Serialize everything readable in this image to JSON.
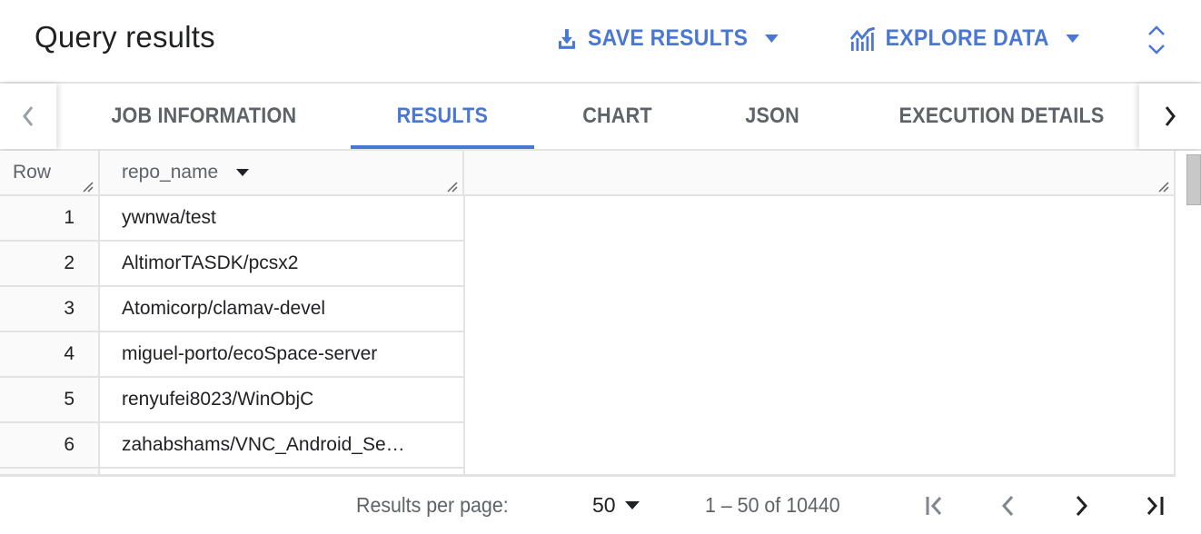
{
  "header": {
    "title": "Query results",
    "save_results_label": "SAVE RESULTS",
    "explore_data_label": "EXPLORE DATA",
    "icons": {
      "save": "download-icon",
      "explore": "chart-icon",
      "expand": "unfold-icon"
    }
  },
  "tabs": [
    {
      "label": "JOB INFORMATION",
      "active": false
    },
    {
      "label": "RESULTS",
      "active": true
    },
    {
      "label": "CHART",
      "active": false
    },
    {
      "label": "JSON",
      "active": false
    },
    {
      "label": "EXECUTION DETAILS",
      "active": false
    }
  ],
  "colors": {
    "accent": "#4a77d4",
    "text": "#202124",
    "muted": "#5f6368",
    "border": "#e3e3e3"
  },
  "table": {
    "columns": [
      "Row",
      "repo_name"
    ],
    "rows": [
      {
        "row": "1",
        "repo_name": "ywnwa/test"
      },
      {
        "row": "2",
        "repo_name": "AltimorTASDK/pcsx2"
      },
      {
        "row": "3",
        "repo_name": "Atomicorp/clamav-devel"
      },
      {
        "row": "4",
        "repo_name": "miguel-porto/ecoSpace-server"
      },
      {
        "row": "5",
        "repo_name": "renyufei8023/WinObjC"
      },
      {
        "row": "6",
        "repo_name": "zahabshams/VNC_Android_Se…"
      }
    ]
  },
  "footer": {
    "results_per_page_label": "Results per page:",
    "per_page_value": "50",
    "range_text": "1 – 50 of 10440"
  }
}
